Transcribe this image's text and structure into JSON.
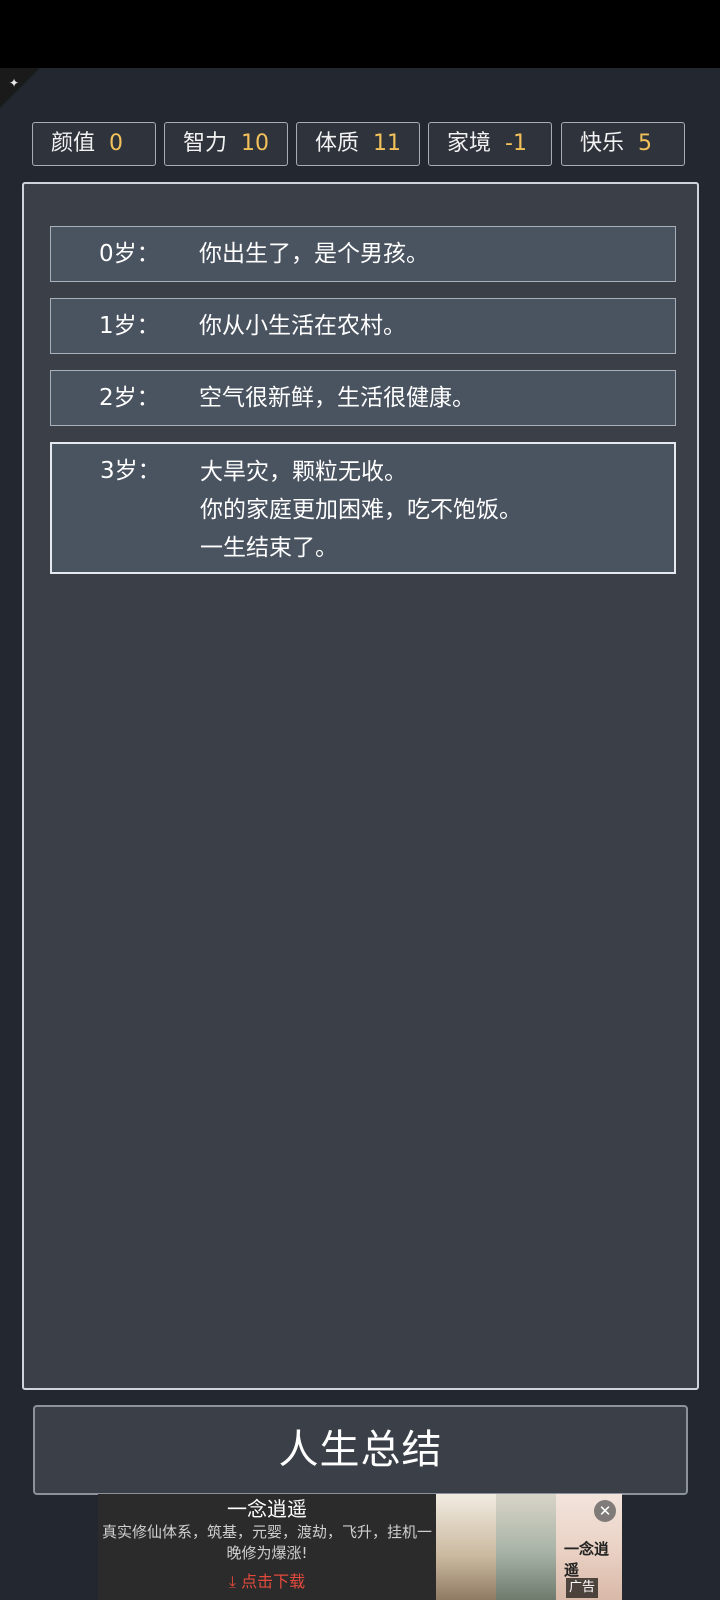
{
  "stats": [
    {
      "label": "颜值",
      "value": "0"
    },
    {
      "label": "智力",
      "value": "10"
    },
    {
      "label": "体质",
      "value": "11"
    },
    {
      "label": "家境",
      "value": "-1"
    },
    {
      "label": "快乐",
      "value": "5"
    }
  ],
  "log": [
    {
      "age": "0岁：",
      "lines": [
        "你出生了，是个男孩。"
      ]
    },
    {
      "age": "1岁：",
      "lines": [
        "你从小生活在农村。"
      ]
    },
    {
      "age": "2岁：",
      "lines": [
        "空气很新鲜，生活很健康。"
      ]
    },
    {
      "age": "3岁：",
      "lines": [
        "大旱灾，颗粒无收。",
        "你的家庭更加困难，吃不饱饭。",
        "一生结束了。"
      ]
    }
  ],
  "summary_button": "人生总结",
  "ad": {
    "title": "一念逍遥",
    "description": "真实修仙体系，筑基，元婴，渡劫，飞升，挂机一晚修为爆涨!",
    "cta": "点击下载",
    "logo_text": "一念逍遥",
    "tag": "广告",
    "close_icon": "close-icon",
    "download_icon": "download-icon"
  },
  "colors": {
    "background": "#232830",
    "panel": "#3a3f48",
    "entry": "#4a5360",
    "stat_value": "#f3c15a",
    "ad_cta": "#e24a3c"
  }
}
